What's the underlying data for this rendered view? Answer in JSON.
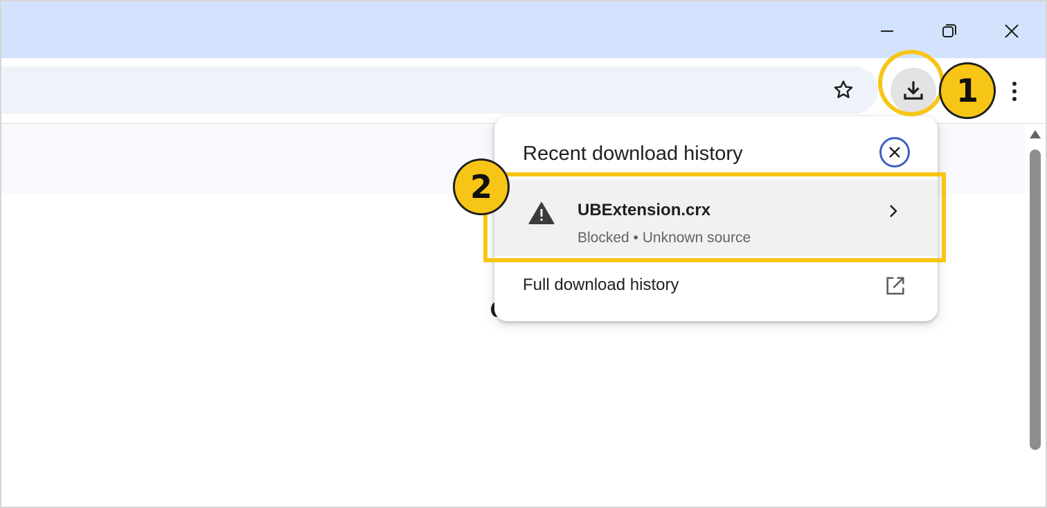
{
  "window_controls": {
    "minimize_icon": "minimize-icon",
    "maximize_icon": "restore-icon",
    "close_icon": "close-icon"
  },
  "toolbar": {
    "bookmark_icon": "star-icon",
    "downloads_icon": "download-icon",
    "menu_icon": "more-vert-icon"
  },
  "annotations": {
    "marker_1": "1",
    "marker_2": "2",
    "color": "#f7c515"
  },
  "download_bubble": {
    "title": "Recent download history",
    "close_icon": "close-circle-icon",
    "items": [
      {
        "icon": "warning-icon",
        "file_name": "UBExtension.crx",
        "status": "Blocked • Unknown source"
      }
    ],
    "full_history_label": "Full download history",
    "full_history_icon": "open-in-new-icon"
  },
  "colors": {
    "title_bar": "#d3e3fd",
    "omnibox": "#eef2f9",
    "accent_blue": "#3b5fc4"
  }
}
